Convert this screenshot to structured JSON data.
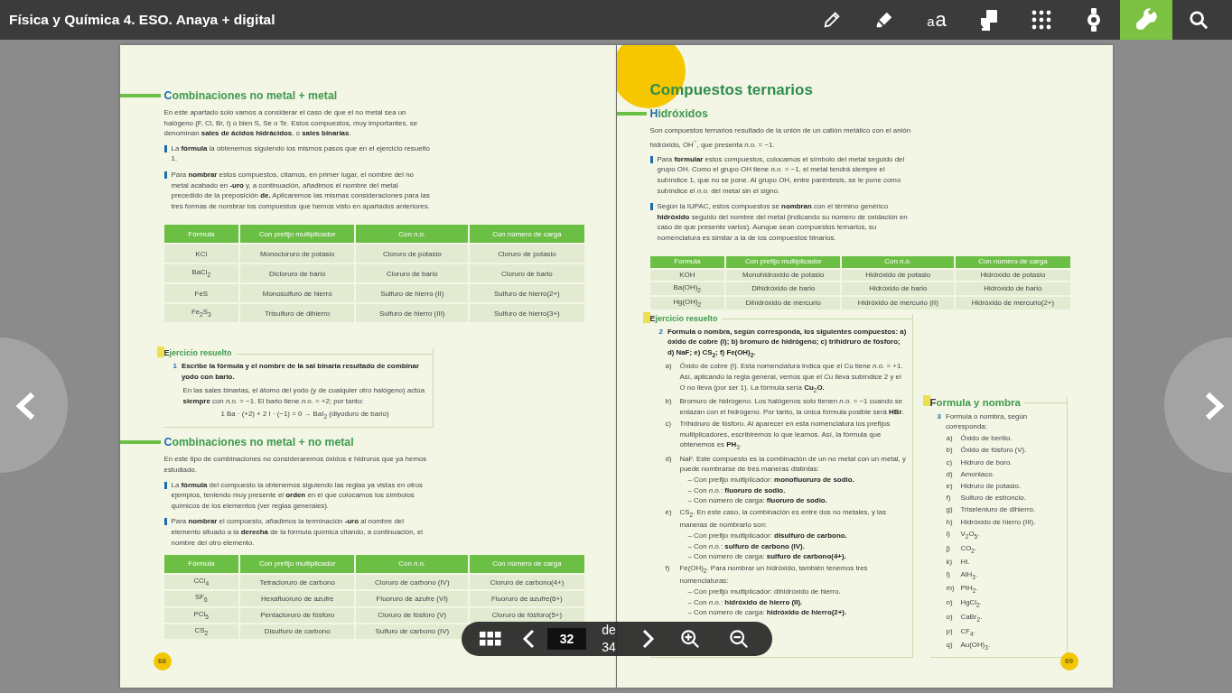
{
  "app": {
    "title": "Física y Química 4. ESO. Anaya + digital",
    "tools": [
      {
        "kind": "pencil",
        "selected": false
      },
      {
        "kind": "highlighter",
        "selected": false
      },
      {
        "kind": "font-size",
        "glyphs": [
          "a",
          "a"
        ],
        "selected": false
      },
      {
        "kind": "note",
        "selected": false
      },
      {
        "kind": "grid",
        "selected": false
      },
      {
        "kind": "badge",
        "selected": false
      },
      {
        "kind": "wrench",
        "selected": true
      },
      {
        "kind": "search",
        "selected": false
      }
    ]
  },
  "pages": [
    {
      "corner_decoration": false,
      "number": "68",
      "blocks": [
        {
          "kind": "heading",
          "text": "Combinaciones no metal + metal"
        },
        {
          "kind": "paragraph",
          "text": "En este apartado solo vamos a considerar el caso de que el no metal sea un halógeno (F, Cl, Br, I) o bien S, Se o Te. Estos compuestos, muy importantes, se denominan **sales de ácidos hidrácidos**, o **sales binarias**."
        },
        {
          "kind": "bullet",
          "text": "La **fórmula** la obtenemos siguiendo los mismos pasos que en el ejercicio resuelto 1."
        },
        {
          "kind": "bullet",
          "text": "Para **nombrar** estos compuestos, citamos, en primer lugar, el nombre del no metal acabado en **-uro** y, a continuación, añadimos el nombre del metal precedido de la preposición **de.** Aplicaremos las mismas consideraciones para las tres formas de nombrar los compuestos que hemos visto en apartados anteriores."
        },
        {
          "kind": "table",
          "columns": [
            "Fórmula",
            "Con prefijo multiplicador",
            "Con *n.o.*",
            "Con número de carga"
          ],
          "rows": [
            [
              "KCl",
              "Monocloruro de potasio",
              "Cloruro de potasio",
              "Cloruro de potasio"
            ],
            [
              "BaCl$_{2}$",
              "Dicloruro de bario",
              "Cloruro de bario",
              "Cloruro de bario"
            ],
            [
              "FeS",
              "Monosulfuro de hierro",
              "Sulfuro de hierro (II)",
              "Sulfuro de hierro(2+)"
            ],
            [
              "Fe$_{2}$S$_{3}$",
              "Trisulfuro de dihierro",
              "Sulfuro de hierro (III)",
              "Sulfuro de hierro(3+)"
            ]
          ]
        },
        {
          "kind": "exercise",
          "title": "Ejercicio resuelto",
          "number": "1",
          "question_bold": true,
          "question": "Escribe la fórmula y el nombre de la sal binaria resultado de combinar yodo con bario.",
          "body": "En las sales binarias, el átomo del yodo (y de cualquier otro halógeno) actúa **siempre** con *n.o.* = −1. El bario tiene *n.o.* = +2; por tanto:",
          "equation": "1 Ba · (+2) + 2 I · (−1) = 0  →  BaI$_{2}$ (diyoduro de bario)"
        },
        {
          "kind": "heading",
          "text": "Combinaciones no metal + no metal"
        },
        {
          "kind": "paragraph",
          "text": "En este tipo de combinaciones no consideraremos óxidos e hidruros que ya hemos estudiado."
        },
        {
          "kind": "bullet",
          "text": "La **fórmula** del compuesto la obtenemos siguiendo las reglas ya vistas en otros ejemplos, teniendo muy presente el **orden** en el que colocamos los símbolos químicos de los elementos (ver reglas generales)."
        },
        {
          "kind": "bullet",
          "text": "Para **nombrar** el compuesto, añadimos la terminación **-uro** al nombre del elemento situado a la **derecha** de la fórmula química citando, a continuación, el nombre del otro elemento."
        },
        {
          "kind": "table",
          "columns": [
            "Fórmula",
            "Con prefijo multiplicador",
            "Con *n.o.*",
            "Con número de carga"
          ],
          "rows": [
            [
              "CCl$_{4}$",
              "Tetracloruro de carbono",
              "Cloruro de carbono (IV)",
              "Cloruro de carbono(4+)"
            ],
            [
              "SF$_{6}$",
              "Hexafluoruro de azufre",
              "Fluoruro de azufre (VI)",
              "Fluoruro de azufre(6+)"
            ],
            [
              "PCl$_{5}$",
              "Pentacloruro de fósforo",
              "Cloruro de fósforo (V)",
              "Cloruro de fósforo(5+)"
            ],
            [
              "CS$_{2}$",
              "Disulfuro de carbono",
              "Sulfuro de carbono (IV)"
            ]
          ]
        }
      ]
    },
    {
      "corner_decoration": true,
      "number": "69",
      "blocks": [
        {
          "kind": "title",
          "text": "Compuestos ternarios"
        },
        {
          "kind": "heading",
          "text": "Hidróxidos"
        },
        {
          "kind": "paragraph",
          "text": "Son compuestos ternarios resultado de la unión de un catión metálico con el anión hidróxido, OH$^{−}$, que presenta *n.o.* = −1."
        },
        {
          "kind": "bullet",
          "text": "Para **formular** estos compuestos, colocamos el símbolo del metal seguido del grupo OH. Como el grupo OH tiene *n.o.* = −1, el metal tendrá siempre el subíndice 1, que no se pone. Al grupo OH, entre paréntesis, se le pone como subíndice el *n.o.* del metal sin el signo."
        },
        {
          "kind": "bullet",
          "text": "Según la IUPAC, estos compuestos se **nombran** con el término genérico **hidróxido** seguido del nombre del metal (indicando su número de oxidación en caso de que presente varios). Aunque sean compuestos ternarios, su nomenclatura es similar a la de los compuestos binarios."
        },
        {
          "kind": "table",
          "columns": [
            "Formula",
            "Con prefijo multiplicador",
            "Con *n.o.*",
            "Con número de carga"
          ],
          "rows": [
            [
              "KOH",
              "Monohidroxido de potasio",
              "Hidróxido de potasio",
              "Hidróxido de potasio"
            ],
            [
              "Ba(OH)$_{2}$",
              "Dihidróxido de bario",
              "Hidróxido de bario",
              "Hidróxido de bario"
            ],
            [
              "Hg(OH)$_{2}$",
              "Dihidróxido de mercurio",
              "Hidróxido de mercurio (II)",
              "Hidróxido de mercurio(2+)"
            ]
          ]
        },
        {
          "kind": "columns",
          "items": [
            {
              "kind": "exercise",
              "title": "Ejercicio resuelto",
              "number": "2",
              "question_bold": true,
              "question": "Formula o nombra, según corresponda, los siguientes compuestos: a) óxido de cobre (I); b) bromuro de hidrógeno; c) trihidruro de fósforo; d) NaF; e) CS$_{2}$; f) Fe(OH)$_{2}$.",
              "items": [
                {
                  "marker": "a)",
                  "text": "Óxido de cobre (I). Esta nomenclatura indica que el Cu tiene *n.o.* = +1. Así, aplicando la regla general, vemos que el Cu lleva subíndice 2 y el O no lleva (por ser 1). La fórmula sería **Cu**$_{2}$**O.**"
                },
                {
                  "marker": "b)",
                  "text": "Bromuro de hidrógeno. Los halógenos solo tienen *n.o.* = −1 cuando se enlazan con el hidrógeno. Por tanto, la única fórmula posible será **HBr**."
                },
                {
                  "marker": "c)",
                  "text": "Trihidruro de fósforo. Al aparecer en esta nomenclatura los prefijos multiplicadores, escribiremos lo que leamos. Así, la fórmula que obtenemos es **PH**$_{3}$."
                },
                {
                  "marker": "d)",
                  "text": "NaF. Este compuesto es la combinación de un no metal con un metal, y puede nombrarse de tres maneras distintas:",
                  "lines": [
                    "– Con prefijo multiplicador: **monofluoruro de sodio.**",
                    "– Con *n.o.*: **fluoruro de sodio.**",
                    "– Con número de carga: **fluoruro de sodio.**"
                  ]
                },
                {
                  "marker": "e)",
                  "text": "CS$_{2}$. En este caso, la combinación es entre dos no metales, y las maneras de nombrarlo son:",
                  "lines": [
                    "– Con prefijo multiplicador: **disulfuro de carbono.**",
                    "– Con *n.o.*: **sulfuro de carbono (IV).**",
                    "– Con número de carga: **sulfuro de carbono(4+).**"
                  ]
                },
                {
                  "marker": "f)",
                  "text": "Fe(OH)$_{2}$. Para nombrar un hidróxido, también tenemos tres nomenclaturas:",
                  "lines": [
                    "– Con prefijo multiplicador: dihidróxido de hierro.",
                    "– Con *n.o.*: **hidróxido de hierro (II).**",
                    "– Con número de carga: **hidróxido de hierro(2+).**"
                  ]
                }
              ]
            },
            {
              "kind": "exercise",
              "title": "Formula y nombra",
              "number": "3",
              "question_bold": false,
              "question": "Formula o nombra, según corresponda:",
              "items": [
                {
                  "marker": "a)",
                  "text": "Óxido de berilio."
                },
                {
                  "marker": "b)",
                  "text": "Óxido de fósforo (V)."
                },
                {
                  "marker": "c)",
                  "text": "Hidruro de boro."
                },
                {
                  "marker": "d)",
                  "text": "Amoniaco."
                },
                {
                  "marker": "e)",
                  "text": "Hidruro de potasio."
                },
                {
                  "marker": "f)",
                  "text": "Sulfuro de estroncio."
                },
                {
                  "marker": "g)",
                  "text": "Triseleniuro de dihierro."
                },
                {
                  "marker": "h)",
                  "text": "Hidróxido de hierro (III)."
                },
                {
                  "marker": "i)",
                  "text": "V$_{2}$O$_{5}$."
                },
                {
                  "marker": "j)",
                  "text": "CO$_{2}$."
                },
                {
                  "marker": "k)",
                  "text": "HI."
                },
                {
                  "marker": "l)",
                  "text": "AlH$_{3}$."
                },
                {
                  "marker": "m)",
                  "text": "PtH$_{2}$."
                },
                {
                  "marker": "n)",
                  "text": "HgCl$_{2}$."
                },
                {
                  "marker": "o)",
                  "text": "CaBr$_{2}$."
                },
                {
                  "marker": "p)",
                  "text": "CF$_{4}$."
                },
                {
                  "marker": "q)",
                  "text": "Au(OH)$_{3}$."
                }
              ]
            }
          ]
        }
      ]
    }
  ],
  "pager": {
    "current": "32",
    "total": "de 34"
  }
}
